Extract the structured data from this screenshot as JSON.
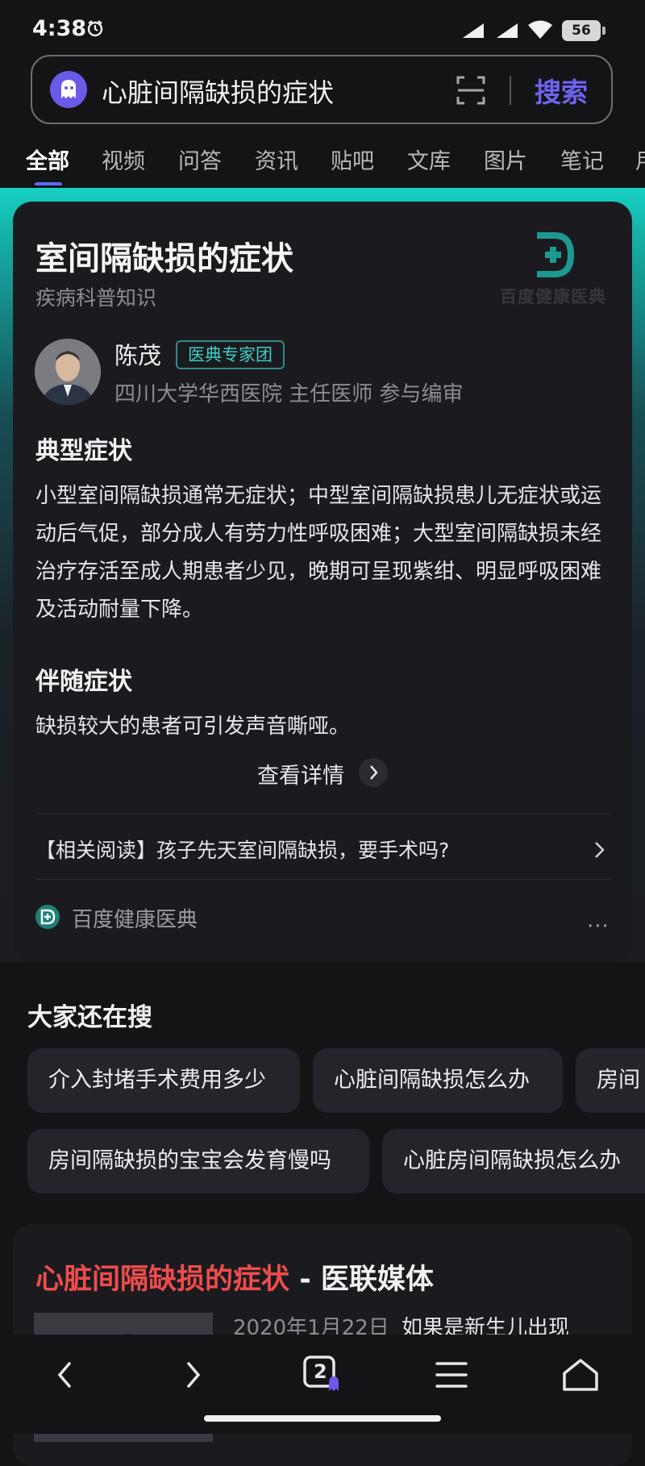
{
  "status": {
    "time": "4:38",
    "battery": "56"
  },
  "search": {
    "query": "心脏间隔缺损的症状",
    "button": "搜索"
  },
  "tabs": [
    "全部",
    "视频",
    "问答",
    "资讯",
    "贴吧",
    "文库",
    "图片",
    "笔记",
    "用"
  ],
  "card": {
    "title": "室间隔缺损的症状",
    "subtitle": "疾病科普知识",
    "logo_text": "百度健康医典",
    "doctor": {
      "name": "陈茂",
      "badge": "医典专家团",
      "info": "四川大学华西医院 主任医师 参与编审"
    },
    "section1": {
      "heading": "典型症状",
      "text": "小型室间隔缺损通常无症状；中型室间隔缺损患儿无症状或运动后气促，部分成人有劳力性呼吸困难；大型室间隔缺损未经治疗存活至成人期患者少见，晚期可呈现紫绀、明显呼吸困难及活动耐量下降。"
    },
    "section2": {
      "heading": "伴随症状",
      "text": "缺损较大的患者可引发声音嘶哑。"
    },
    "more": "查看详情",
    "related": "【相关阅读】孩子先天室间隔缺损，要手术吗?",
    "source": "百度健康医典",
    "more_menu": "···"
  },
  "others": {
    "title": "大家还在搜",
    "chips": [
      "介入封堵手术费用多少",
      "心脏间隔缺损怎么办",
      "房间",
      "房间隔缺损的宝宝会发育慢吗",
      "心脏房间隔缺损怎么办"
    ]
  },
  "result": {
    "title_highlight": "心脏间隔缺损的症状",
    "title_rest": " - 医联媒体",
    "date": "2020年1月22日",
    "snippet": "如果是新生儿出现"
  },
  "nav": {
    "tab_count": "2"
  },
  "colors": {
    "accent": "#6e63f0",
    "teal": "#17d1c4",
    "highlight": "#f04c4c"
  }
}
